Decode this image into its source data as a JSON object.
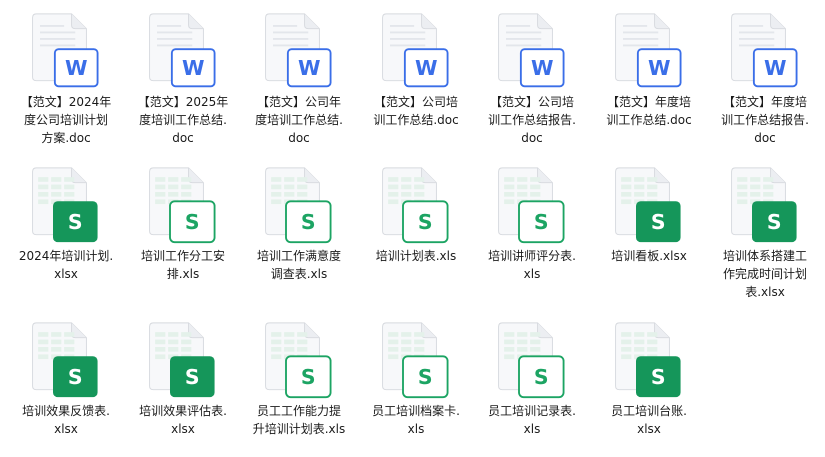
{
  "files": [
    {
      "name": "【范文】2024年\n度公司培训计划\n方案.doc",
      "type": "word"
    },
    {
      "name": "【范文】2025年\n度培训工作总结.\ndoc",
      "type": "word"
    },
    {
      "name": "【范文】公司年\n度培训工作总结.\ndoc",
      "type": "word"
    },
    {
      "name": "【范文】公司培\n训工作总结.doc",
      "type": "word"
    },
    {
      "name": "【范文】公司培\n训工作总结报告.\ndoc",
      "type": "word"
    },
    {
      "name": "【范文】年度培\n训工作总结.doc",
      "type": "word"
    },
    {
      "name": "【范文】年度培\n训工作总结报告.\ndoc",
      "type": "word"
    },
    {
      "name": "2024年培训计划.\nxlsx",
      "type": "xlsx"
    },
    {
      "name": "培训工作分工安\n排.xls",
      "type": "xls"
    },
    {
      "name": "培训工作满意度\n调查表.xls",
      "type": "xls"
    },
    {
      "name": "培训计划表.xls",
      "type": "xls"
    },
    {
      "name": "培训讲师评分表.\nxls",
      "type": "xls"
    },
    {
      "name": "培训看板.xlsx",
      "type": "xlsx"
    },
    {
      "name": "培训体系搭建工\n作完成时间计划\n表.xlsx",
      "type": "xlsx"
    },
    {
      "name": "培训效果反馈表.\nxlsx",
      "type": "xlsx"
    },
    {
      "name": "培训效果评估表.\nxlsx",
      "type": "xlsx"
    },
    {
      "name": "员工工作能力提\n升培训计划表.xls",
      "type": "xls"
    },
    {
      "name": "员工培训档案卡.\nxls",
      "type": "xls"
    },
    {
      "name": "员工培训记录表.\nxls",
      "type": "xls"
    },
    {
      "name": "员工培训台账.\nxlsx",
      "type": "xlsx"
    }
  ],
  "icon_glyphs": {
    "word": "W",
    "sheet": "S"
  },
  "colors": {
    "word_blue": "#3a6ee8",
    "word_badge_bg": "#ffffff",
    "xlsx_green": "#15965a",
    "xls_green": "#1ca463",
    "page_bg": "#f7f8fa",
    "page_border": "#d6d9de"
  }
}
